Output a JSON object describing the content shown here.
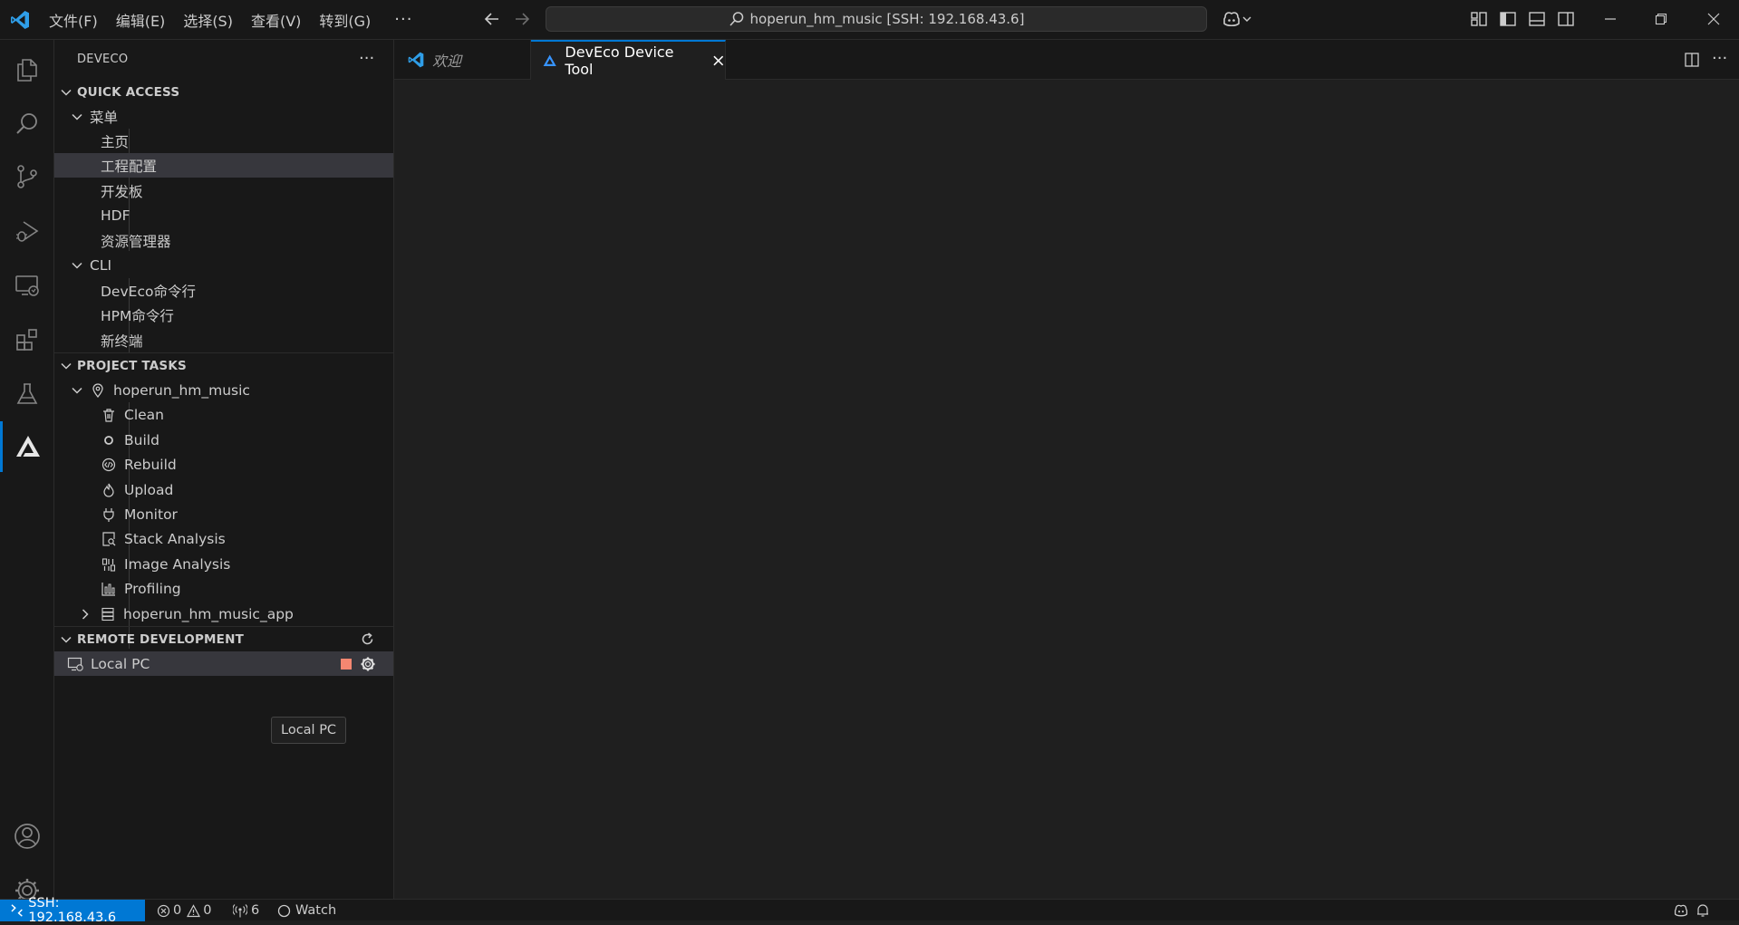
{
  "titlebar": {
    "menu": [
      "文件(F)",
      "编辑(E)",
      "选择(S)",
      "查看(V)",
      "转到(G)"
    ],
    "more": "···",
    "search": "hoperun_hm_music [SSH: 192.168.43.6]"
  },
  "activity_bar": {
    "items": [
      "explorer-icon",
      "search-icon",
      "source-control-icon",
      "run-debug-icon",
      "remote-explorer-icon",
      "extensions-icon",
      "testing-icon",
      "deveco-icon"
    ],
    "bottom": [
      "accounts-icon",
      "manage-gear-icon"
    ]
  },
  "sidebar": {
    "title": "DEVECO",
    "more": "···",
    "quick_access": {
      "header": "QUICK ACCESS",
      "menu_group": "菜单",
      "menu_items": [
        "主页",
        "工程配置",
        "开发板",
        "HDF",
        "资源管理器"
      ],
      "selected": "工程配置",
      "cli_group": "CLI",
      "cli_items": [
        "DevEco命令行",
        "HPM命令行",
        "新终端"
      ]
    },
    "project_tasks": {
      "header": "PROJECT TASKS",
      "project": "hoperun_hm_music",
      "tasks": [
        "Clean",
        "Build",
        "Rebuild",
        "Upload",
        "Monitor",
        "Stack Analysis",
        "Image Analysis",
        "Profiling"
      ],
      "sub_project": "hoperun_hm_music_app"
    },
    "remote_development": {
      "header": "REMOTE DEVELOPMENT",
      "item": "Local PC",
      "tooltip": "Local PC"
    }
  },
  "editor": {
    "tabs": [
      {
        "label": "欢迎",
        "active": false
      },
      {
        "label": "DevEco Device Tool",
        "active": true
      }
    ]
  },
  "statusbar": {
    "remote": "SSH: 192.168.43.6",
    "errors": "0",
    "warnings": "0",
    "ports": "6",
    "watch": "Watch"
  },
  "colors": {
    "accent": "#0078d4",
    "background": "#1f1f1f",
    "sidebar": "#181818",
    "stop_button": "#f48771"
  }
}
